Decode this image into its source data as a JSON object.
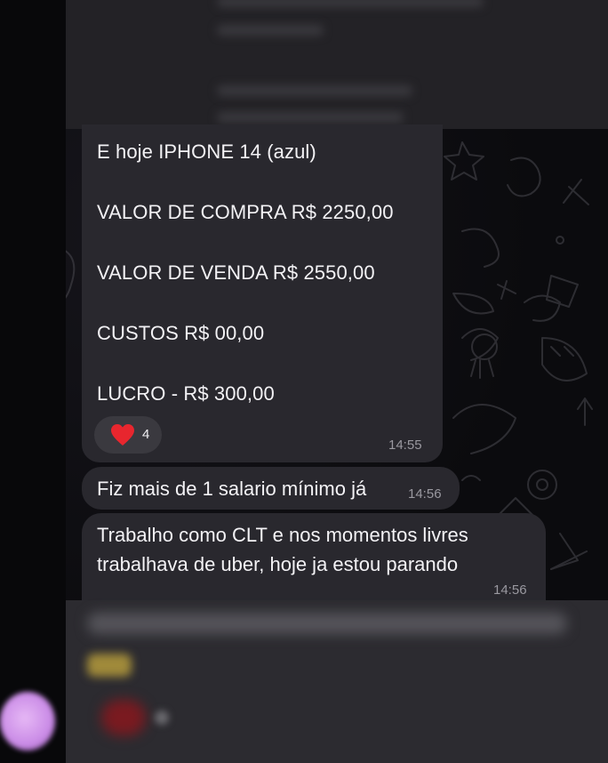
{
  "messages": [
    {
      "lines": [
        "E hoje IPHONE 14 (azul)",
        "VALOR DE COMPRA R$ 2250,00",
        "VALOR DE VENDA R$ 2550,00",
        "CUSTOS R$ 00,00",
        "LUCRO - R$ 300,00"
      ],
      "reaction": {
        "icon": "heart-icon",
        "count": "4"
      },
      "time": "14:55"
    },
    {
      "text": "Fiz mais de 1 salario mínimo já",
      "time": "14:56"
    },
    {
      "lines": [
        "Trabalho como CLT e nos momentos livres",
        "trabalhava de uber, hoje ja estou parando"
      ],
      "time": "14:56"
    }
  ],
  "colors": {
    "bubble": "#29282e",
    "reaction_bg": "#3a393f",
    "heart": "#e8262e",
    "time_text": "#9a99a0"
  }
}
